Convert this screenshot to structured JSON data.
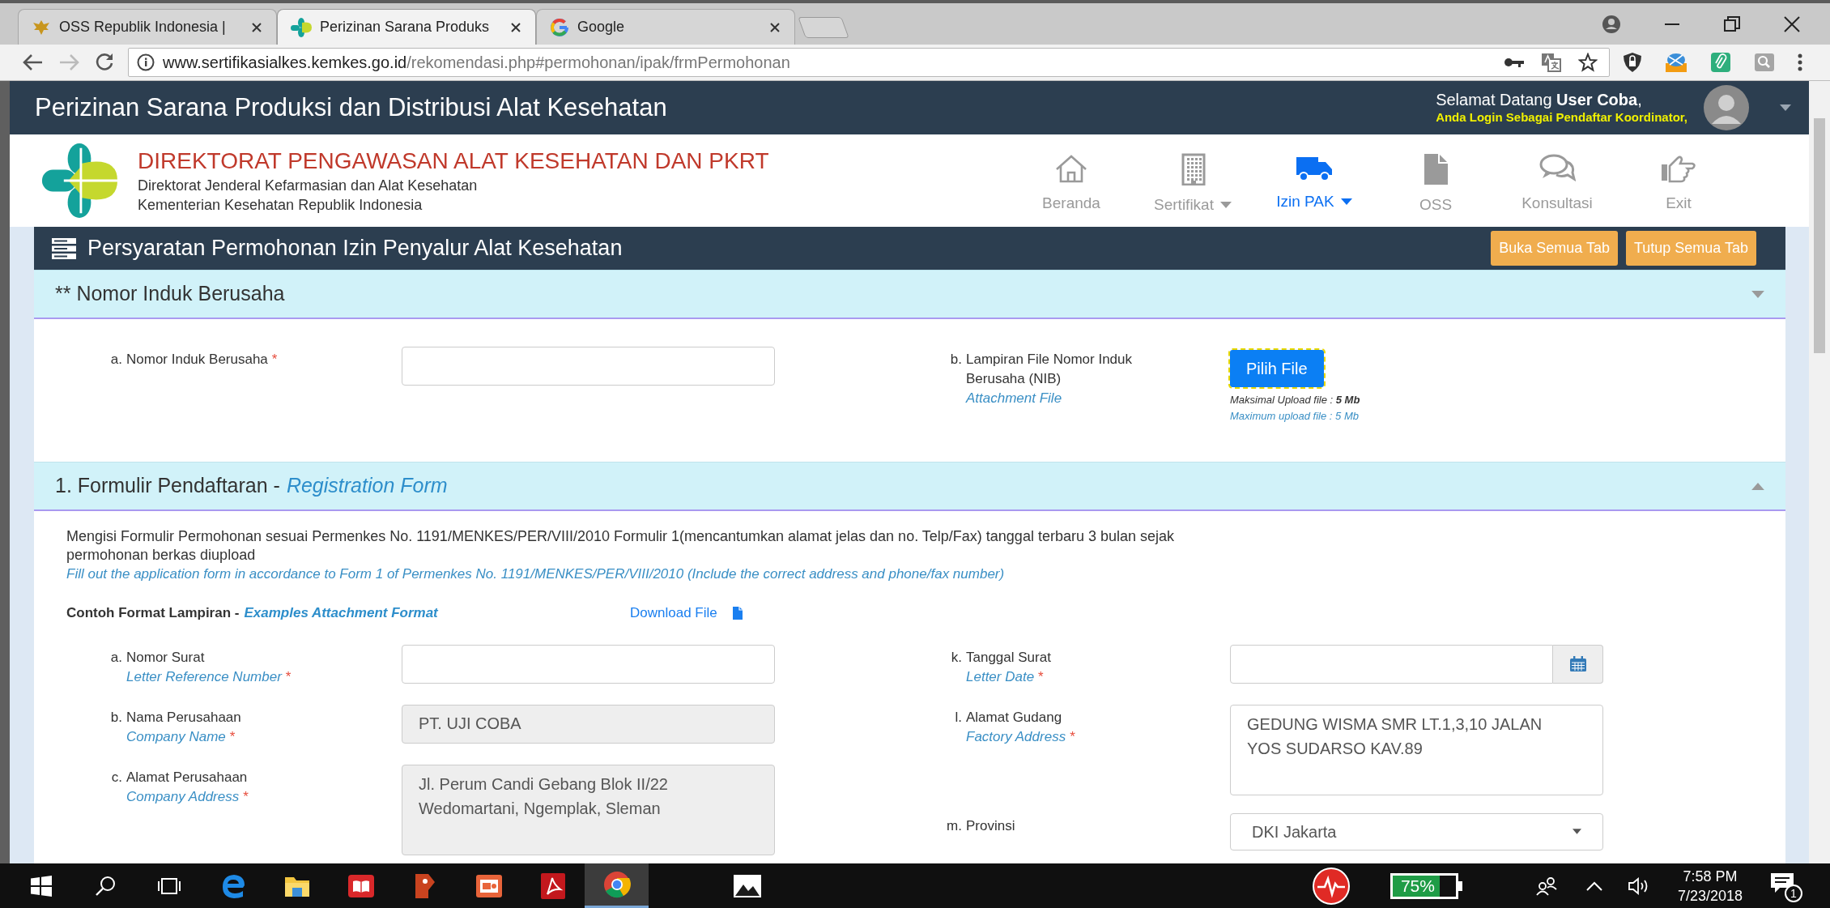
{
  "browser": {
    "tabs": [
      {
        "title": "OSS Republik Indonesia |",
        "kind": "emblem",
        "selected": false
      },
      {
        "title": "Perizinan Sarana Produks",
        "kind": "kemkes",
        "selected": true
      },
      {
        "title": "Google",
        "kind": "google",
        "selected": false
      }
    ],
    "url": {
      "host": "www.sertifikasialkes.kemkes.go.id",
      "path": "/rekomendasi.php#permohonan/ipak/frmPermohonan"
    }
  },
  "app_bar": {
    "title": "Perizinan Sarana Produksi dan Distribusi Alat Kesehatan",
    "greeting": "Selamat Datang **User Coba**,",
    "role": "Anda Login Sebagai Pendaftar Koordinator,"
  },
  "brand": {
    "title": "DIREKTORAT PENGAWASAN ALAT KESEHATAN DAN PKRT",
    "lines": [
      "Direktorat Jenderal Kefarmasian dan Alat Kesehatan",
      "Kementerian Kesehatan Republik Indonesia"
    ]
  },
  "nav": [
    {
      "label": "Beranda",
      "kind": "home",
      "selected": false,
      "dropdown": false
    },
    {
      "label": "Sertifikat",
      "kind": "building",
      "selected": false,
      "dropdown": true
    },
    {
      "label": "Izin PAK",
      "kind": "truck",
      "selected": true,
      "dropdown": true
    },
    {
      "label": "OSS",
      "kind": "file",
      "selected": false,
      "dropdown": false
    },
    {
      "label": "Konsultasi",
      "kind": "chat",
      "selected": false,
      "dropdown": false
    },
    {
      "label": "Exit",
      "kind": "hand",
      "selected": false,
      "dropdown": false
    }
  ],
  "page_title": "Persyaratan Permohonan Izin Penyalur Alat Kesehatan",
  "page_buttons": [
    "Buka Semua Tab",
    "Tutup Semua Tab"
  ],
  "sections": [
    {
      "title": "** Nomor Induk Berusaha",
      "expanded": false,
      "columns": [
        [
          {
            "prefix": "a.",
            "label": "Nomor Induk Berusaha",
            "mark": "*",
            "kind": "text",
            "readonly": false
          }
        ],
        [
          {
            "prefix": "b.",
            "label": "Lampiran File Nomor Induk Berusaha (NIB)",
            "label_en": "Attachment File",
            "kind": "file",
            "button": "Pilih File",
            "note": "Maksimal Upload file : **5 Mb**",
            "note_en": "Maximum upload file : 5 Mb"
          }
        ]
      ]
    },
    {
      "title": "1. Formulir Pendaftaran -",
      "title_en": "Registration Form",
      "expanded": true,
      "intro": "Mengisi Formulir Permohonan sesuai Permenkes No. 1191/MENKES/PER/VIII/2010 Formulir 1(mencantumkan alamat jelas dan no. Telp/Fax) tanggal terbaru 3 bulan sejak permohonan berkas diupload",
      "intro_en": "Fill out the application form in accordance to Form 1 of Permenkes No. 1191/MENKES/PER/VIII/2010 (Include the correct address and phone/fax number)",
      "example": {
        "label": "Contoh Format Lampiran -",
        "label_en": "Examples Attachment Format",
        "link": "Download File"
      },
      "columns": [
        [
          {
            "prefix": "a.",
            "label": "Nomor Surat",
            "label_en": "Letter Reference Number",
            "mark": "*",
            "kind": "text",
            "readonly": false
          },
          {
            "prefix": "b.",
            "label": "Nama Perusahaan",
            "label_en": "Company Name",
            "mark": "*",
            "kind": "text",
            "readonly": true,
            "value": "PT. UJI COBA"
          },
          {
            "prefix": "c.",
            "label": "Alamat Perusahaan",
            "label_en": "Company Address",
            "mark": "*",
            "kind": "textarea",
            "readonly": true,
            "value": "Jl. Perum Candi Gebang Blok II/22 Wedomartani, Ngemplak, Sleman"
          }
        ],
        [
          {
            "prefix": "k.",
            "label": "Tanggal Surat",
            "label_en": "Letter Date",
            "mark": "*",
            "kind": "date"
          },
          {
            "prefix": "l.",
            "label": "Alamat Gudang",
            "label_en": "Factory Address",
            "mark": "*",
            "kind": "textarea",
            "readonly": false,
            "value": "GEDUNG WISMA SMR LT.1,3,10 JALAN YOS SUDARSO KAV.89"
          },
          {
            "prefix": "m.",
            "label": "Provinsi",
            "kind": "select",
            "value": "DKI Jakarta"
          }
        ]
      ]
    }
  ],
  "taskbar": {
    "apps": [
      {
        "kind": "start",
        "selected": false
      },
      {
        "kind": "search",
        "selected": false
      },
      {
        "kind": "taskview",
        "selected": false
      },
      {
        "kind": "edge",
        "selected": false
      },
      {
        "kind": "folder",
        "selected": false
      },
      {
        "kind": "book",
        "selected": false
      },
      {
        "kind": "tag",
        "selected": false
      },
      {
        "kind": "slides",
        "selected": false
      },
      {
        "kind": "pdf",
        "selected": false
      },
      {
        "kind": "chrome",
        "selected": true
      },
      {
        "kind": "image",
        "selected": false
      }
    ],
    "battery": "75%",
    "time": "7:58 PM",
    "date": "7/23/2018",
    "notifications": "1"
  }
}
